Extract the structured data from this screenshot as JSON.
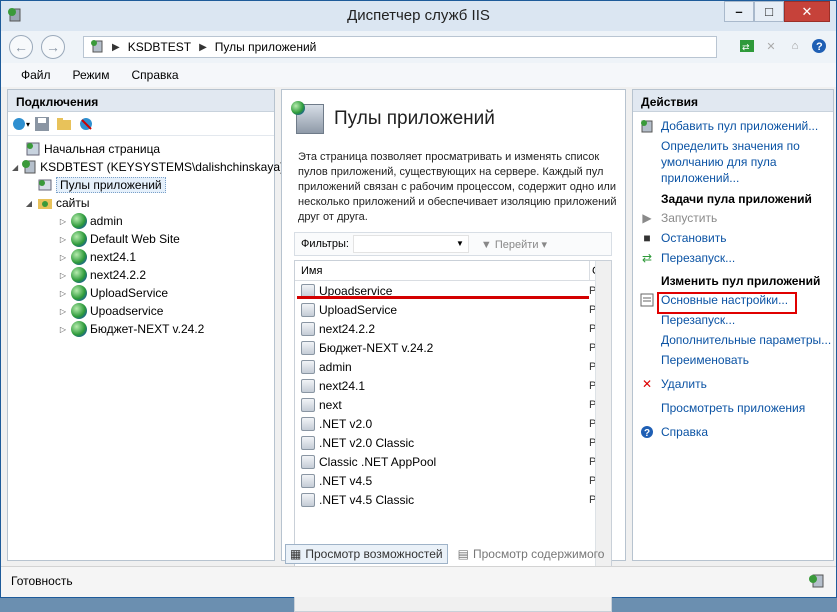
{
  "window": {
    "title": "Диспетчер служб IIS"
  },
  "address": {
    "server": "KSDBTEST",
    "page": "Пулы приложений"
  },
  "menu": {
    "file": "Файл",
    "mode": "Режим",
    "help": "Справка"
  },
  "connections": {
    "title": "Подключения",
    "tree": {
      "start": "Начальная страница",
      "server": "KSDBTEST (KEYSYSTEMS\\dalishchinskaya)",
      "pools": "Пулы приложений",
      "sites": "сайты",
      "site_items": [
        "admin",
        "Default Web Site",
        "next24.1",
        "next24.2.2",
        "UploadService",
        "Upoadservice",
        "Бюджет-NEXT v.24.2"
      ]
    }
  },
  "center": {
    "title": "Пулы приложений",
    "description": "Эта страница позволяет просматривать и изменять список пулов приложений, существующих на сервере. Каждый пул приложений связан с рабочим процессом, содержит одно или несколько приложений и обеспечивает изоляцию приложений друг от друга.",
    "filter_label": "Фильтры:",
    "go_label": "Перейти",
    "column_name": "Имя",
    "column_status": "С",
    "rows": [
      "Upoadservice",
      "UploadService",
      "next24.2.2",
      "Бюджет-NEXT v.24.2",
      "admin",
      "next24.1",
      "next",
      ".NET v2.0",
      ".NET v2.0 Classic",
      "Classic .NET AppPool",
      ".NET v4.5",
      ".NET v4.5 Classic"
    ],
    "row_status": "Р",
    "tab_features": "Просмотр возможностей",
    "tab_content": "Просмотр содержимого"
  },
  "actions": {
    "title": "Действия",
    "add_pool": "Добавить пул приложений...",
    "set_defaults": "Определить значения по умолчанию для пула приложений...",
    "tasks_header": "Задачи пула приложений",
    "start": "Запустить",
    "stop": "Остановить",
    "recycle": "Перезапуск...",
    "edit_header": "Изменить пул приложений",
    "basic": "Основные настройки...",
    "recycle2": "Перезапуск...",
    "advanced": "Дополнительные параметры...",
    "rename": "Переименовать",
    "delete": "Удалить",
    "view_apps": "Просмотреть приложения",
    "help": "Справка"
  },
  "status": {
    "text": "Готовность"
  }
}
